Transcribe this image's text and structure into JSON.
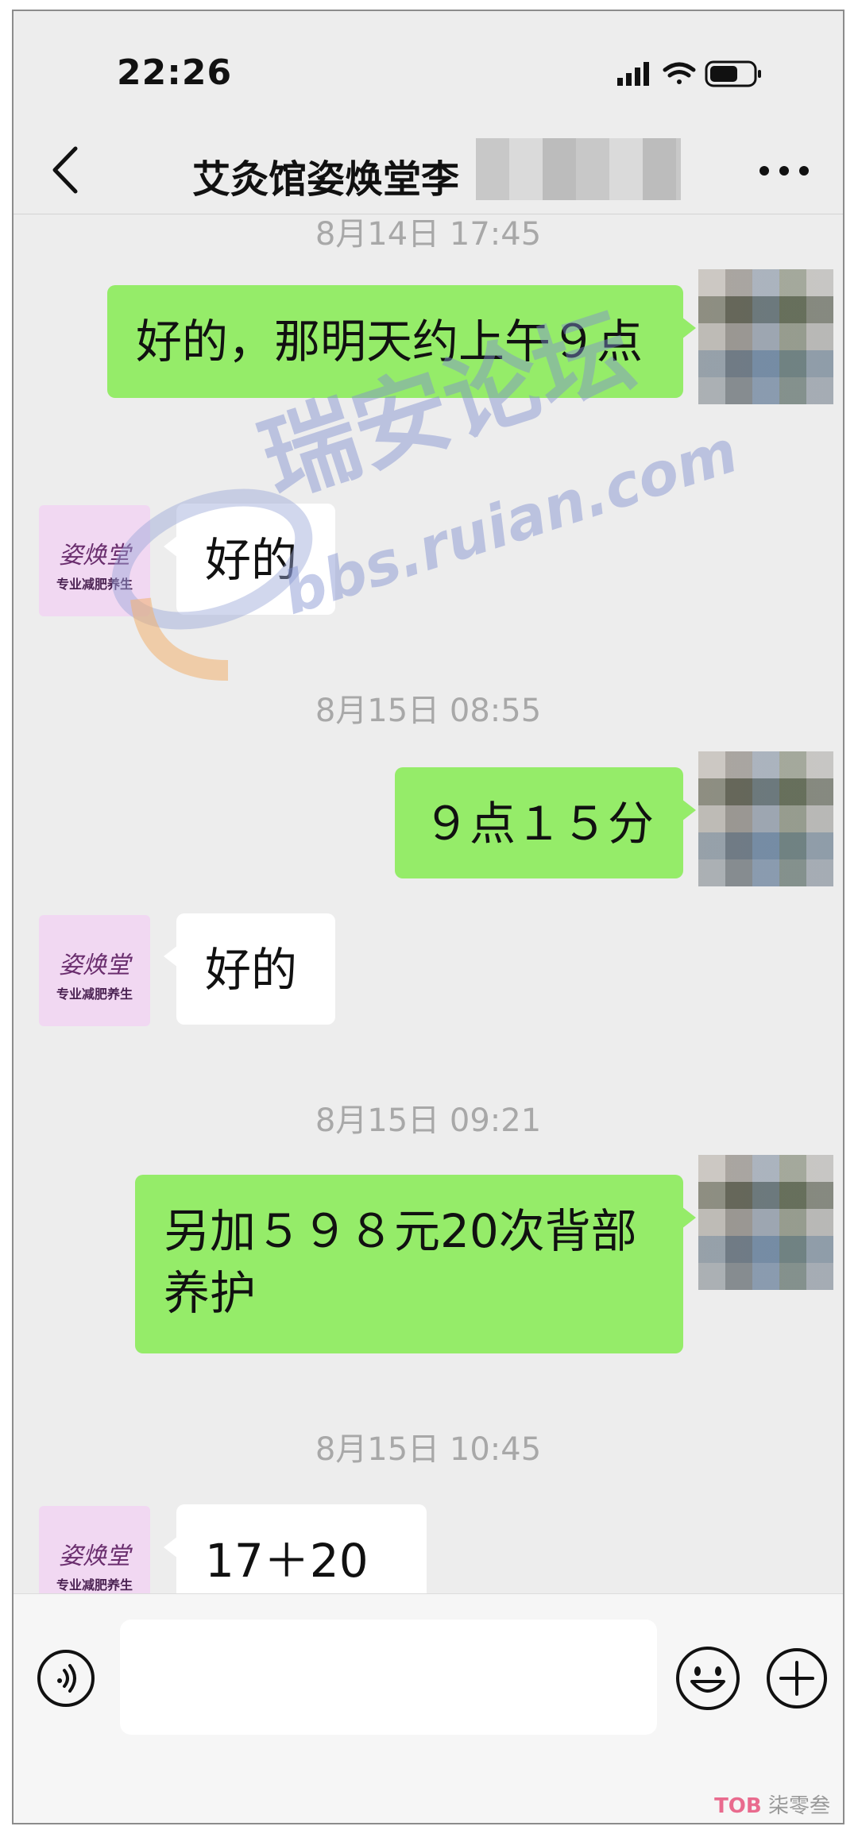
{
  "status_bar": {
    "time": "22:26"
  },
  "header": {
    "title": "艾灸馆姿焕堂李"
  },
  "messages": [
    {
      "type": "timestamp",
      "text": "8月14日 17:45"
    },
    {
      "type": "outgoing",
      "text": "好的，那明天约上午９点"
    },
    {
      "type": "incoming",
      "text": "好的"
    },
    {
      "type": "timestamp",
      "text": "8月15日 08:55"
    },
    {
      "type": "outgoing",
      "text": "９点１５分"
    },
    {
      "type": "incoming",
      "text": "好的"
    },
    {
      "type": "timestamp",
      "text": "8月15日 09:21"
    },
    {
      "type": "outgoing",
      "text": "另加５９８元20次背部养护"
    },
    {
      "type": "timestamp",
      "text": "8月15日 10:45"
    },
    {
      "type": "incoming",
      "text": "17＋20"
    }
  ],
  "shop_avatar": {
    "brand": "姿焕堂",
    "tagline": "专业减肥养生"
  },
  "watermark": {
    "main": "瑞安论坛",
    "url": "bbs.ruian.com"
  },
  "footer_logo": {
    "mark": "TOB",
    "text": "柒零叁"
  },
  "colors": {
    "outgoing_bubble": "#95ec69",
    "incoming_bubble": "#ffffff",
    "chat_background": "#ededed"
  }
}
